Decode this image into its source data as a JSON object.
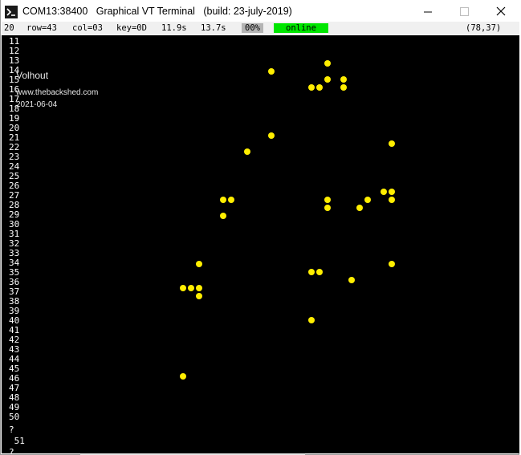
{
  "window": {
    "title": "COM13:38400   Graphical VT Terminal   (build: 23-july-2019)",
    "app_icon": "terminal-prompt-icon"
  },
  "status": {
    "line_no": "20",
    "row": "row=43",
    "col": "col=03",
    "key": "key=0D",
    "time1": "11.9s",
    "time2": "13.7s",
    "percent": "00%",
    "state": "online",
    "coords": "(78,37)",
    "colors": {
      "online": "#00e600",
      "percent_bg": "#b4b4b4"
    }
  },
  "terminal": {
    "lines": [
      "11",
      "12",
      "13",
      "14",
      "15",
      "16",
      "17",
      "18",
      "19",
      "20",
      "21",
      "22",
      "23",
      "24",
      "25",
      "26",
      "27",
      "28",
      "29",
      "30",
      "31",
      "32",
      "33",
      "34",
      "35",
      "36",
      "37",
      "38",
      "39",
      "40",
      "41",
      "42",
      "43",
      "44",
      "45",
      "46",
      "47",
      "48",
      "49",
      "50",
      "?",
      " 51",
      "?"
    ],
    "overlay": {
      "author": "Volhout",
      "website": "www.thebackshed.com",
      "date": "2021-06-04"
    },
    "dots_color": "#ffee00"
  }
}
